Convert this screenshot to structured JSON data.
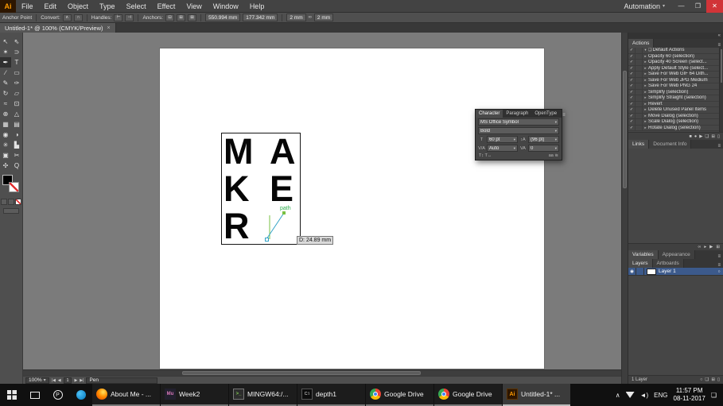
{
  "menubar": {
    "app_icon": "Ai",
    "items": [
      "File",
      "Edit",
      "Object",
      "Type",
      "Select",
      "Effect",
      "View",
      "Window",
      "Help"
    ],
    "workspace": "Automation",
    "win": {
      "minimize": "—",
      "restore": "❐",
      "close": "✕"
    }
  },
  "control_bar": {
    "mode_label": "Anchor Point",
    "convert_label": "Convert:",
    "handles_label": "Handles:",
    "anchors_label": "Anchors:",
    "x_value": "550.994 mm",
    "y_value": "177.342 mm",
    "w_value": "2 mm",
    "h_value": "2 mm"
  },
  "doc_tab": {
    "title": "Untitled-1* @ 100% (CMYK/Preview)"
  },
  "tools": [
    "↖",
    "⇖",
    "✶",
    "⊃",
    "✒",
    "T",
    "∕",
    "▭",
    "✎",
    "✑",
    "↻",
    "▱",
    "≈",
    "⊡",
    "⊕",
    "△",
    "▦",
    "▤",
    "◉",
    "◑",
    "✳",
    "▙",
    "▣",
    "✂",
    "✣",
    "Q"
  ],
  "canvas": {
    "letters": [
      "M",
      "A",
      "K",
      "E",
      "R"
    ],
    "measurement": "D: 24.89 mm",
    "smart_guide": "path"
  },
  "character_panel": {
    "tabs": [
      "Character",
      "Paragraph",
      "OpenType"
    ],
    "font_family": "MS Office Symbol",
    "font_style": "Bold",
    "size": "60 pt",
    "leading": "(96 pt)",
    "kerning": "Auto",
    "tracking": "0"
  },
  "actions_panel": {
    "tab": "Actions",
    "set_name": "Default Actions",
    "items": [
      "Opacity 60 (selection)",
      "Opacity 40 Screen (select...",
      "Apply Default Style (select...",
      "Save For Web GIF 64 Dith...",
      "Save For Web JPG Medium",
      "Save For Web PNG 24",
      "Simplify (selection)",
      "Simplify Straight (selection)",
      "Revert",
      "Delete Unused Panel Items",
      "Move Dialog (selection)",
      "Scale Dialog (selection)",
      "Rotate Dialog (selection)"
    ]
  },
  "links_panel": {
    "tabs": [
      "Links",
      "Document Info"
    ]
  },
  "mid_tabs": [
    "Variables",
    "Appearance"
  ],
  "layers_panel": {
    "tabs": [
      "Layers",
      "Artboards"
    ],
    "layer_name": "Layer 1",
    "count": "1 Layer"
  },
  "status_bar": {
    "zoom": "100%",
    "artboard": "1",
    "tool": "Pen"
  },
  "taskbar": {
    "apps": [
      {
        "label": "About Me - ..."
      },
      {
        "label": "Week2"
      },
      {
        "label": "MINGW64:/..."
      },
      {
        "label": "depth1"
      },
      {
        "label": "Google Drive"
      },
      {
        "label": "Google Drive"
      },
      {
        "label": "Untitled-1* ..."
      }
    ],
    "tray": {
      "language": "ENG",
      "time": "11:57 PM",
      "date": "08-11-2017"
    }
  },
  "icons": {
    "dropdown": "▾",
    "close_tab": "×",
    "collapse": "«",
    "panel_menu": "≡",
    "check": "✓",
    "arrow_right": "▸",
    "arrow_down": "▾",
    "folder": "❑",
    "stop": "■",
    "record": "●",
    "play": "▶",
    "new": "⊞",
    "trash": "▯",
    "eye": "◉",
    "target": "○",
    "link": "∞",
    "nav_first": "|◀",
    "nav_prev": "◀",
    "nav_next": "▶",
    "nav_last": "▶|",
    "convert_corner": "∧",
    "convert_smooth": "∩",
    "handle_show": "⊢",
    "handle_hide": "⊣",
    "anchor_remove": "⊟",
    "anchor_add": "⊞",
    "anchor_cut": "⊠",
    "size_icon": "T",
    "leading_icon": "↕A",
    "kern_icon": "V/A",
    "track_icon": "VA",
    "cp_misc_left": "T↕ T↔",
    "cp_misc_right": "aa ≋",
    "tray_up": "∧",
    "speaker": "◄)",
    "action_center": "❏",
    "people": "P",
    "mu_label": "Mu",
    "ai_label": "Ai",
    "cmd_label": "C:\\",
    "mintty_label": ">_"
  }
}
